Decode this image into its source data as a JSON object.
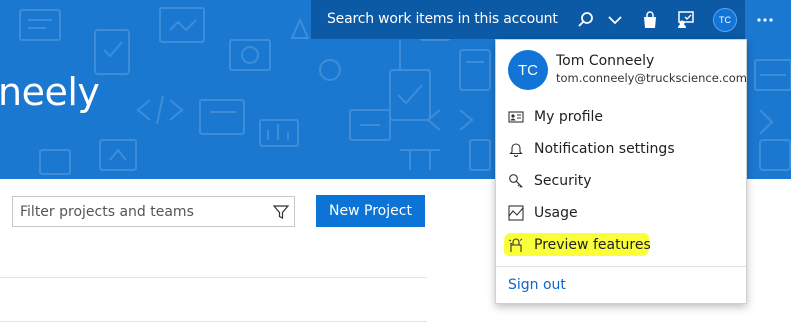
{
  "banner": {
    "title_fragment": "neely",
    "color": "#1b78d0"
  },
  "topnav": {
    "search_placeholder": "Search work items in this account",
    "avatar_initials": "TC",
    "icons": [
      "search-icon",
      "chevron-down-icon",
      "shopping-bag-icon",
      "feedback-icon",
      "more-icon"
    ]
  },
  "content": {
    "filter_placeholder": "Filter projects and teams",
    "new_project_label": "New Project"
  },
  "profile_menu": {
    "avatar_initials": "TC",
    "name": "Tom Conneely",
    "email": "tom.conneely@truckscience.com",
    "items": [
      {
        "label": "My profile",
        "icon": "profile-card-icon"
      },
      {
        "label": "Notification settings",
        "icon": "bell-icon"
      },
      {
        "label": "Security",
        "icon": "key-icon"
      },
      {
        "label": "Usage",
        "icon": "usage-chart-icon"
      },
      {
        "label": "Preview features",
        "icon": "preview-features-icon",
        "highlighted": true
      }
    ],
    "sign_out_label": "Sign out",
    "highlight_color": "#fbff3a"
  }
}
